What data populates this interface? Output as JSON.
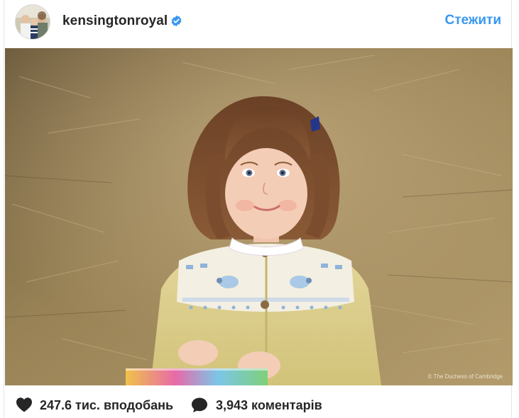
{
  "post": {
    "username": "kensingtonroyal",
    "verified": true,
    "follow_label": "Стежити",
    "photo_credit": "© The Duchess of Cambridge",
    "likes_text": "247.6 тис. вподобань",
    "comments_text": "3,943 коментарів"
  },
  "icons": {
    "avatar": "profile-avatar",
    "verified": "verified-badge-icon",
    "likes": "heart-icon",
    "comments": "comment-bubble-icon"
  },
  "colors": {
    "accent": "#3897f0",
    "text": "#262626",
    "border": "#e6e6e6"
  }
}
